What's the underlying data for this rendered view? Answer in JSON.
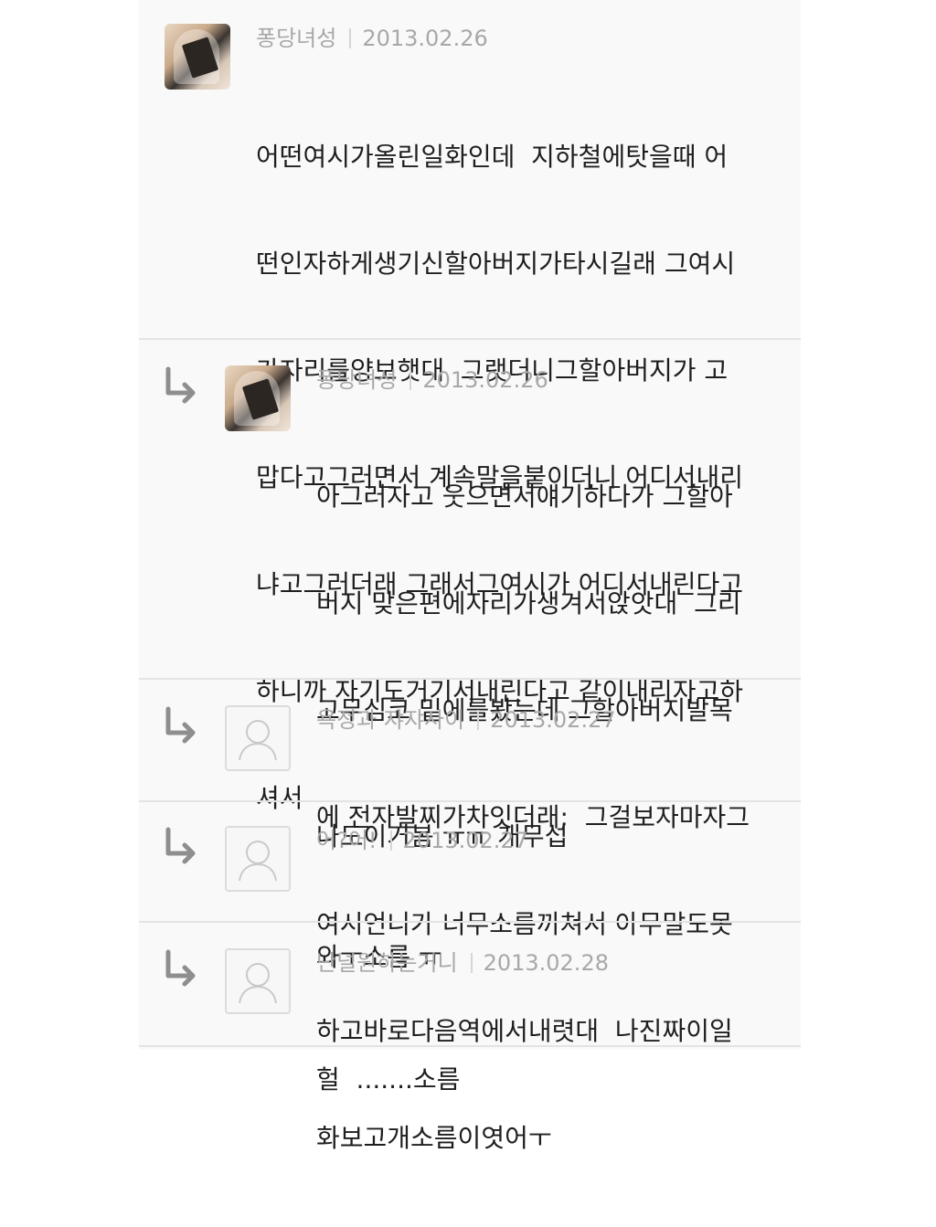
{
  "comments": [
    {
      "author": "퐁당녀성",
      "date": "2013.02.26",
      "avatar": "profile-photo",
      "is_reply": false,
      "lines": [
        "어떤여시가올린일화인데  지하철에탓을때 어",
        "떤인자하게생기신할아버지가타시길래 그여시",
        "가자리를양보햇대  그랫더니그할아버지가 고",
        "맙다고그러면서 계속말을붙이더니 어디서내리",
        "냐고그러더래 그래서그여시가 어디서내린다고",
        "하니까 자기도거기서내린다고 같이내리자고하",
        "셔서"
      ]
    },
    {
      "author": "퐁당녀성",
      "date": "2013.02.26",
      "avatar": "profile-photo",
      "is_reply": true,
      "lines": [
        "아그러자고 웃으면서얘기하다가 그할아",
        "버지 맞은편에자리가생겨서앉앗대  그리",
        "고무심코 밑에를봤는데 그할아버지발목",
        "에 전자발찌가차잇더래;  그걸보자마자그",
        "여시언니가 너무소름끼쳐서 아무말도못",
        "하고바로다음역에서내렷대  나진짜이일",
        "화보고개소름이엿어ㅜ"
      ]
    },
    {
      "author": "욕정과 쟈쟈사이",
      "date": "2013.02.27",
      "avatar": "default-user",
      "is_reply": true,
      "lines": [
        "나도이거봄 ㅠㅠ 개무섭"
      ]
    },
    {
      "author": "어?어!",
      "date": "2013.02.27",
      "avatar": "default-user",
      "is_reply": true,
      "lines": [
        "와ㅜ소름 ㅠ"
      ]
    },
    {
      "author": "난널원하는거니",
      "date": "2013.02.28",
      "avatar": "default-user",
      "is_reply": true,
      "lines": [
        "헐  .......소름"
      ]
    }
  ],
  "colors": {
    "author": "#a8a8a8",
    "text": "#1e1e1e",
    "divider": "#e3e3e3",
    "arrow": "#8e8e8e"
  },
  "icons": {
    "reply": "reply-arrow-icon",
    "default_avatar": "default-user-icon"
  }
}
